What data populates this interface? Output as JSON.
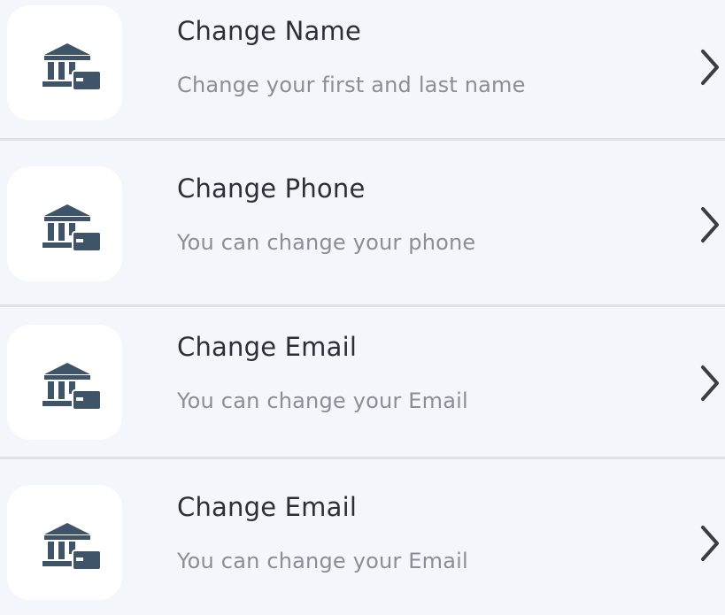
{
  "colors": {
    "background": "#f3f6fa",
    "tile": "#ffffff",
    "icon": "#3f5468",
    "title_text": "#2b2f36",
    "subtitle_text": "#8a8f96",
    "divider": "#dfe3e8"
  },
  "items": [
    {
      "icon": "bank-card-icon",
      "title": "Change Name",
      "subtitle": "Change your first and last name",
      "chevron_icon": "chevron-right-icon"
    },
    {
      "icon": "bank-card-icon",
      "title": "Change Phone",
      "subtitle": "You can change your phone",
      "chevron_icon": "chevron-right-icon"
    },
    {
      "icon": "bank-card-icon",
      "title": "Change Email",
      "subtitle": "You can change your Email",
      "chevron_icon": "chevron-right-icon"
    },
    {
      "icon": "bank-card-icon",
      "title": "Change Email",
      "subtitle": "You can change your Email",
      "chevron_icon": "chevron-right-icon"
    }
  ]
}
